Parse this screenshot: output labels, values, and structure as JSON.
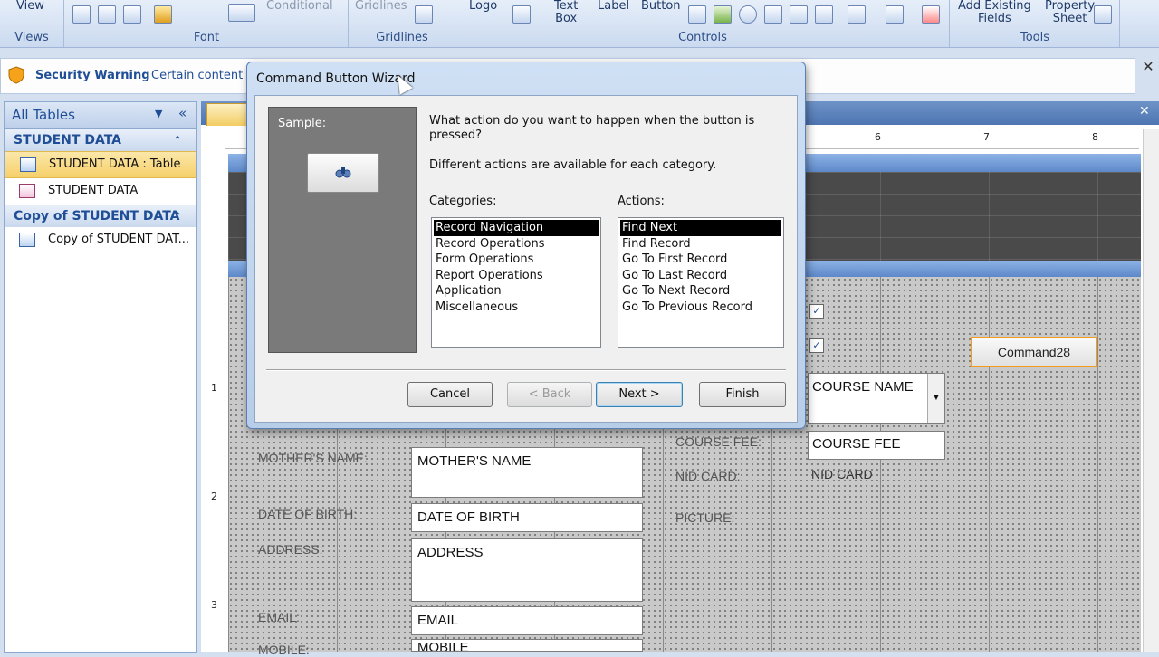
{
  "ribbon": {
    "view_label": "View",
    "conditional_label": "Conditional",
    "gridlines_label": "Gridlines",
    "logo_label": "Logo",
    "textbox_label": "Text\nBox",
    "label_label": "Label",
    "button_label": "Button",
    "add_fields_label": "Add Existing\nFields",
    "property_sheet_label": "Property\nSheet",
    "groups": [
      "Views",
      "Font",
      "Gridlines",
      "Controls",
      "Tools"
    ]
  },
  "security_bar": {
    "title": "Security Warning",
    "message": "Certain content"
  },
  "nav_pane": {
    "header": "All Tables",
    "groups": [
      {
        "title": "STUDENT DATA",
        "items": [
          {
            "label": "STUDENT DATA : Table",
            "icon": "table-icon",
            "selected": true
          },
          {
            "label": "STUDENT DATA",
            "icon": "form-icon",
            "selected": false
          }
        ]
      },
      {
        "title": "Copy of STUDENT DATA",
        "items": [
          {
            "label": "Copy of STUDENT DAT...",
            "icon": "table-icon",
            "selected": false
          }
        ]
      }
    ]
  },
  "form": {
    "labels": {
      "mother": "MOTHER'S NAME:",
      "dob": "DATE OF BIRTH:",
      "address": "ADDRESS:",
      "email": "EMAIL:",
      "mobile": "MOBILE:",
      "course_fee": "COURSE FEE:",
      "nid": "NID CARD:",
      "picture": "PICTURE:"
    },
    "fields": {
      "mother": "MOTHER'S NAME",
      "dob": "DATE OF BIRTH",
      "address": "ADDRESS",
      "email": "EMAIL",
      "mobile": "MOBILE",
      "course_name": "COURSE NAME",
      "course_fee": "COURSE FEE",
      "nid": "NID CARD"
    },
    "command_button": "Command28",
    "ruler_marks": [
      "6",
      "7",
      "8"
    ],
    "vruler_marks": [
      "1",
      "2",
      "3"
    ]
  },
  "dialog": {
    "title": "Command Button Wizard",
    "sample_label": "Sample:",
    "question": "What action do you want to happen when the button is pressed?",
    "hint": "Different actions are available for each category.",
    "categories_label": "Categories:",
    "actions_label": "Actions:",
    "categories": [
      "Record Navigation",
      "Record Operations",
      "Form Operations",
      "Report Operations",
      "Application",
      "Miscellaneous"
    ],
    "actions": [
      "Find Next",
      "Find Record",
      "Go To First Record",
      "Go To Last Record",
      "Go To Next Record",
      "Go To Previous Record"
    ],
    "buttons": {
      "cancel": "Cancel",
      "back": "< Back",
      "next": "Next >",
      "finish": "Finish"
    }
  }
}
